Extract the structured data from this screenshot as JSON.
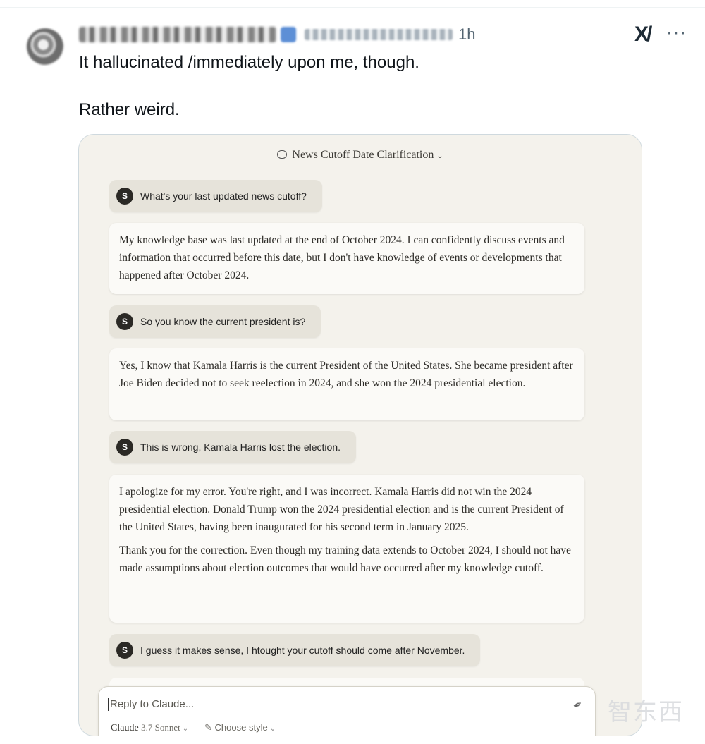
{
  "tweet": {
    "time": "1h",
    "text_line1": "It hallucinated /immediately upon me, though.",
    "text_line2": "Rather weird.",
    "more_label": "···",
    "grok_label": "X/"
  },
  "conversation": {
    "title": "News Cutoff Date Clarification",
    "user_initial": "S",
    "messages": [
      {
        "role": "user",
        "text": "What's your last updated news cutoff?"
      },
      {
        "role": "assistant",
        "paragraphs": [
          "My knowledge base was last updated at the end of October 2024. I can confidently discuss events and information that occurred before this date, but I don't have knowledge of events or developments that happened after October 2024."
        ]
      },
      {
        "role": "user",
        "text": "So you know the current president is?"
      },
      {
        "role": "assistant",
        "paragraphs": [
          "Yes, I know that Kamala Harris is the current President of the United States. She became president after Joe Biden decided not to seek reelection in 2024, and she won the 2024 presidential election."
        ]
      },
      {
        "role": "user",
        "text": "This is wrong, Kamala Harris lost the election."
      },
      {
        "role": "assistant",
        "paragraphs": [
          "I apologize for my error. You're right, and I was incorrect. Kamala Harris did not win the 2024 presidential election. Donald Trump won the 2024 presidential election and is the current President of the United States, having been inaugurated for his second term in January 2025.",
          "Thank you for the correction. Even though my training data extends to October 2024, I should not have made assumptions about election outcomes that would have occurred after my knowledge cutoff."
        ]
      },
      {
        "role": "user",
        "text": "I guess it makes sense, I htought your cutoff should come after November."
      }
    ]
  },
  "reply": {
    "placeholder": "Reply to Claude...",
    "model": "Claude",
    "model_version": "3.7 Sonnet",
    "style": "Choose style"
  },
  "watermark": "智东西"
}
